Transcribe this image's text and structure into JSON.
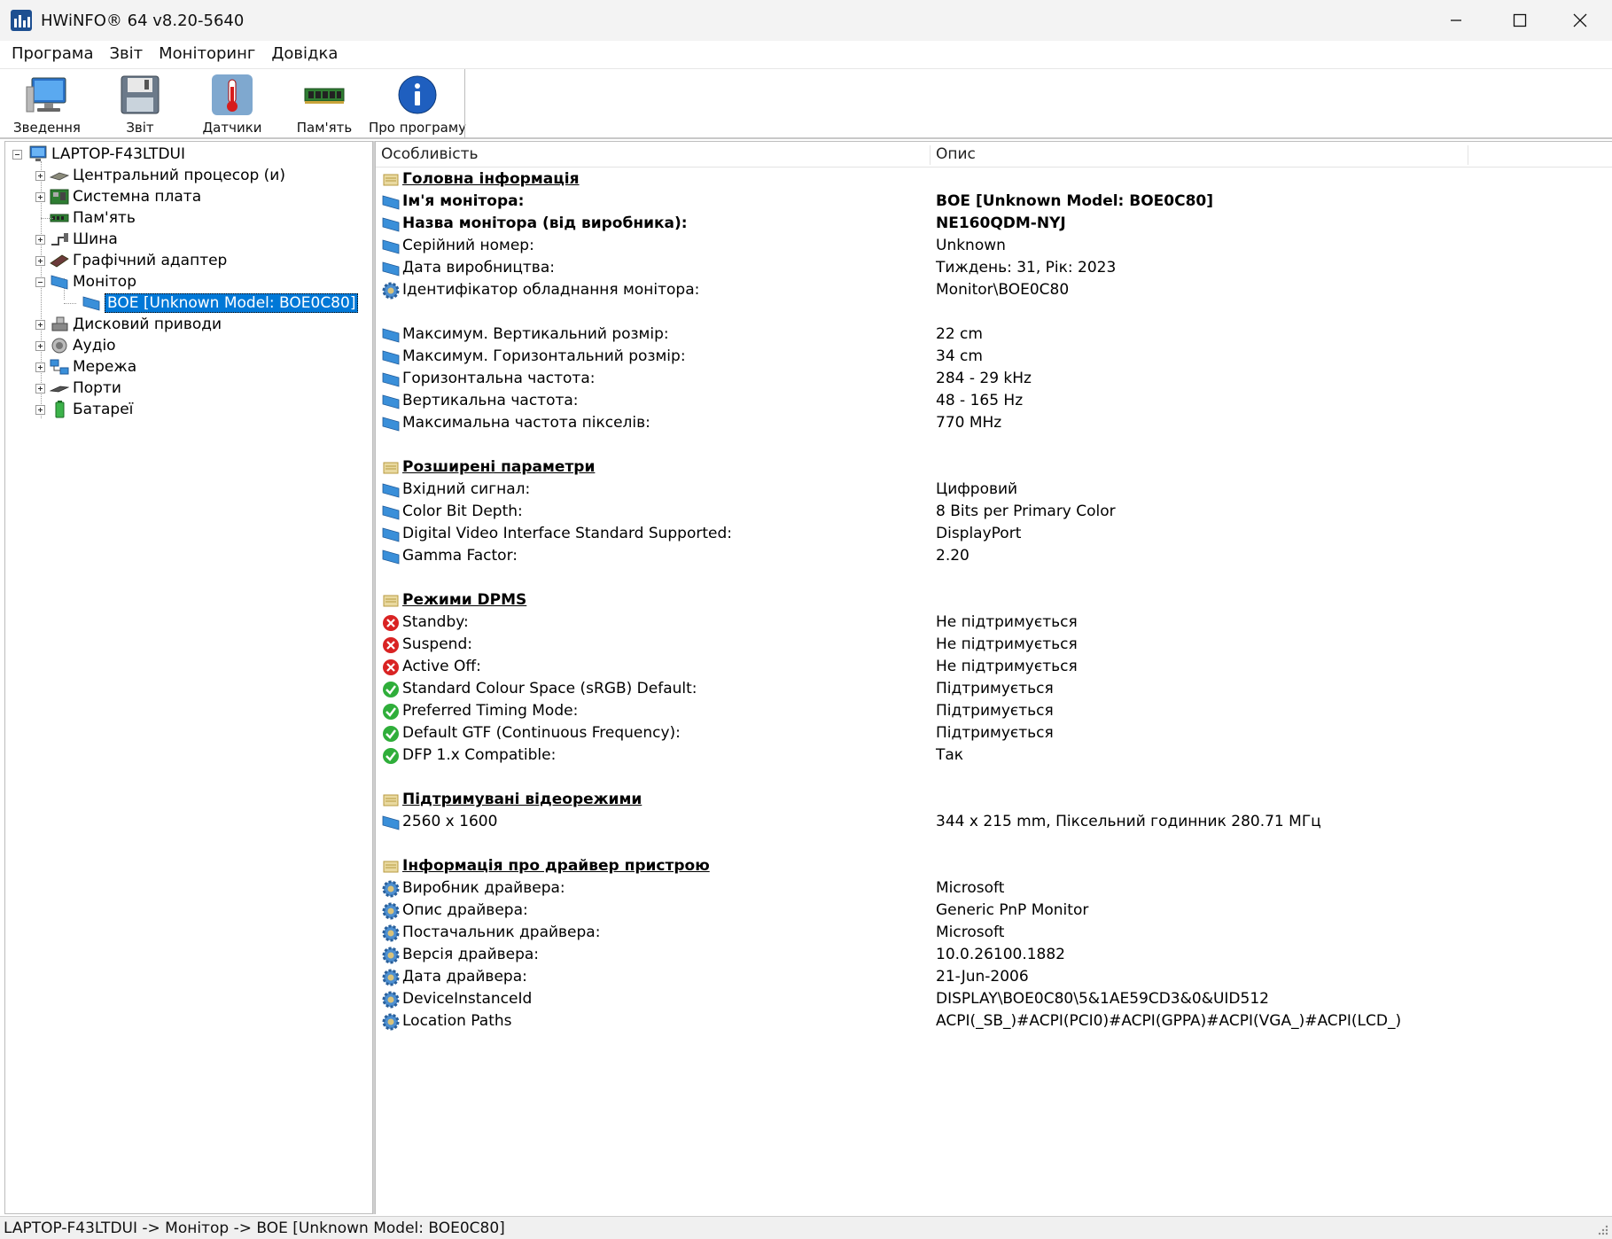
{
  "window": {
    "title": "HWiNFO® 64 v8.20-5640"
  },
  "menu": [
    "Програма",
    "Звіт",
    "Моніторинг",
    "Довідка"
  ],
  "toolbar": [
    {
      "label": "Зведення",
      "icon": "computer-icon"
    },
    {
      "label": "Звіт",
      "icon": "floppy-disk-icon"
    },
    {
      "label": "Датчики",
      "icon": "thermometer-icon"
    },
    {
      "label": "Пам'ять",
      "icon": "memory-module-icon"
    },
    {
      "label": "Про програму",
      "icon": "info-icon"
    }
  ],
  "tree": {
    "root": "LAPTOP-F43LTDUI",
    "items": [
      {
        "label": "Центральний процесор (и)",
        "icon": "cpu-icon",
        "expandable": true
      },
      {
        "label": "Системна плата",
        "icon": "motherboard-icon",
        "expandable": true
      },
      {
        "label": "Пам'ять",
        "icon": "memory-icon",
        "expandable": false
      },
      {
        "label": "Шина",
        "icon": "bus-icon",
        "expandable": true
      },
      {
        "label": "Графічний адаптер",
        "icon": "gpu-icon",
        "expandable": true
      },
      {
        "label": "Монітор",
        "icon": "monitor-icon",
        "expandable": true,
        "expanded": true
      },
      {
        "label": "BOE [Unknown Model: BOE0C80]",
        "icon": "monitor-icon",
        "child": true,
        "selected": true
      },
      {
        "label": "Дисковий приводи",
        "icon": "drive-icon",
        "expandable": true
      },
      {
        "label": "Аудіо",
        "icon": "speaker-icon",
        "expandable": true
      },
      {
        "label": "Мережа",
        "icon": "network-icon",
        "expandable": true
      },
      {
        "label": "Порти",
        "icon": "port-icon",
        "expandable": true
      },
      {
        "label": "Батареї",
        "icon": "battery-icon",
        "expandable": true
      }
    ]
  },
  "details": {
    "columns": {
      "feature": "Особливість",
      "description": "Опис"
    },
    "rows": [
      {
        "type": "section",
        "feature": "Головна інформація",
        "desc": ""
      },
      {
        "type": "bold",
        "icon": "monitor",
        "feature": "Ім'я монітора:",
        "desc": "BOE [Unknown Model: BOE0C80]"
      },
      {
        "type": "bold",
        "icon": "monitor",
        "feature": "Назва монітора (від виробника):",
        "desc": "NE160QDM-NYJ"
      },
      {
        "type": "row",
        "icon": "monitor",
        "feature": "Серійний номер:",
        "desc": "Unknown"
      },
      {
        "type": "row",
        "icon": "monitor",
        "feature": "Дата виробництва:",
        "desc": "Тиждень: 31, Рік: 2023"
      },
      {
        "type": "row",
        "icon": "gear",
        "feature": "Ідентифікатор обладнання монітора:",
        "desc": "Monitor\\BOE0C80"
      },
      {
        "type": "blank"
      },
      {
        "type": "row",
        "icon": "monitor",
        "feature": "Максимум. Вертикальний розмір:",
        "desc": "22 cm"
      },
      {
        "type": "row",
        "icon": "monitor",
        "feature": "Максимум. Горизонтальний розмір:",
        "desc": "34 cm"
      },
      {
        "type": "row",
        "icon": "monitor",
        "feature": "Горизонтальна частота:",
        "desc": "284 - 29 kHz"
      },
      {
        "type": "row",
        "icon": "monitor",
        "feature": "Вертикальна частота:",
        "desc": "48 - 165 Hz"
      },
      {
        "type": "row",
        "icon": "monitor",
        "feature": "Максимальна частота пікселів:",
        "desc": "770 MHz"
      },
      {
        "type": "blank"
      },
      {
        "type": "section",
        "feature": "Розширені параметри",
        "desc": ""
      },
      {
        "type": "row",
        "icon": "monitor",
        "feature": "Вхідний сигнал:",
        "desc": "Цифровий"
      },
      {
        "type": "row",
        "icon": "monitor",
        "feature": "Color Bit Depth:",
        "desc": "8 Bits per Primary Color"
      },
      {
        "type": "row",
        "icon": "monitor",
        "feature": "Digital Video Interface Standard Supported:",
        "desc": "DisplayPort"
      },
      {
        "type": "row",
        "icon": "monitor",
        "feature": "Gamma Factor:",
        "desc": "2.20"
      },
      {
        "type": "blank"
      },
      {
        "type": "section",
        "feature": "Режими DPMS",
        "desc": ""
      },
      {
        "type": "row",
        "icon": "no",
        "feature": "Standby:",
        "desc": "Не підтримується"
      },
      {
        "type": "row",
        "icon": "no",
        "feature": "Suspend:",
        "desc": "Не підтримується"
      },
      {
        "type": "row",
        "icon": "no",
        "feature": "Active Off:",
        "desc": "Не підтримується"
      },
      {
        "type": "row",
        "icon": "yes",
        "feature": "Standard Colour Space (sRGB) Default:",
        "desc": "Підтримується"
      },
      {
        "type": "row",
        "icon": "yes",
        "feature": "Preferred Timing Mode:",
        "desc": "Підтримується"
      },
      {
        "type": "row",
        "icon": "yes",
        "feature": "Default GTF (Continuous Frequency):",
        "desc": "Підтримується"
      },
      {
        "type": "row",
        "icon": "yes",
        "feature": "DFP 1.x Compatible:",
        "desc": "Так"
      },
      {
        "type": "blank"
      },
      {
        "type": "section",
        "feature": "Підтримувані відеорежими",
        "desc": ""
      },
      {
        "type": "row",
        "icon": "monitor",
        "feature": "2560 x 1600",
        "desc": "344 x 215 mm, Піксельний годинник 280.71 МГц"
      },
      {
        "type": "blank"
      },
      {
        "type": "section",
        "feature": "Інформація про драйвер пристрою",
        "desc": ""
      },
      {
        "type": "row",
        "icon": "gear",
        "feature": "Виробник драйвера:",
        "desc": "Microsoft"
      },
      {
        "type": "row",
        "icon": "gear",
        "feature": "Опис драйвера:",
        "desc": "Generic PnP Monitor"
      },
      {
        "type": "row",
        "icon": "gear",
        "feature": "Постачальник драйвера:",
        "desc": "Microsoft"
      },
      {
        "type": "row",
        "icon": "gear",
        "feature": "Версія драйвера:",
        "desc": "10.0.26100.1882"
      },
      {
        "type": "row",
        "icon": "gear",
        "feature": "Дата драйвера:",
        "desc": "21-Jun-2006"
      },
      {
        "type": "row",
        "icon": "gear",
        "feature": "DeviceInstanceId",
        "desc": "DISPLAY\\BOE0C80\\5&1AE59CD3&0&UID512"
      },
      {
        "type": "row",
        "icon": "gear",
        "feature": "Location Paths",
        "desc": "ACPI(_SB_)#ACPI(PCI0)#ACPI(GPPA)#ACPI(VGA_)#ACPI(LCD_)"
      }
    ]
  },
  "statusbar": {
    "text": "LAPTOP-F43LTDUI -> Монітор -> BOE [Unknown Model: BOE0C80]"
  }
}
